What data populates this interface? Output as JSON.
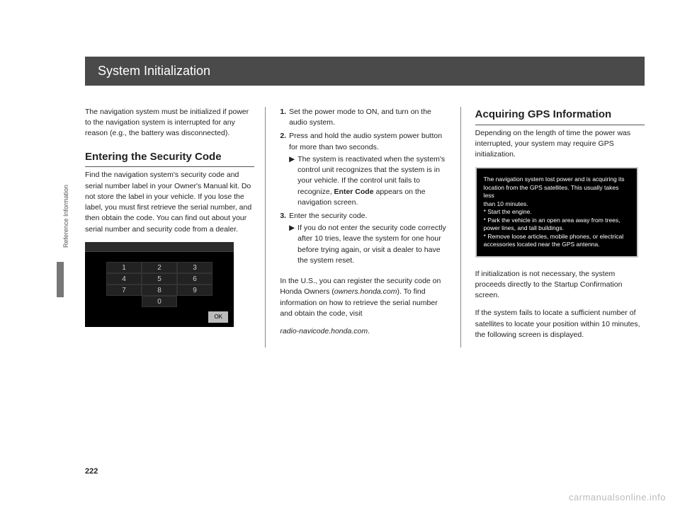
{
  "sidebar": {
    "label": "Reference Information"
  },
  "page_number": "222",
  "watermark": "carmanualsonline.info",
  "header": {
    "title": "System Initialization"
  },
  "col1": {
    "intro": "The navigation system must be initialized if power to the navigation system is interrupted for any reason (e.g., the battery was disconnected).",
    "heading": "Entering the Security Code",
    "body": "Find the navigation system's security code and serial number label in your Owner's Manual kit. Do not store the label in your vehicle. If you lose the label, you must first retrieve the serial number, and then obtain the code. You can find out about your serial number and security code from a dealer.",
    "keypad": [
      "1",
      "2",
      "3",
      "4",
      "5",
      "6",
      "7",
      "8",
      "9",
      "",
      "0",
      ""
    ],
    "ok": "OK"
  },
  "col2": {
    "step1_num": "1.",
    "step1": "Set the power mode to ON, and turn on the audio system.",
    "step2_num": "2.",
    "step2": "Press and hold the audio system power button for more than two seconds.",
    "step2_sub_a": "The system is reactivated when the system's control unit recognizes that the system is in your vehicle. If the control unit fails to recognize, ",
    "step2_sub_bold": "Enter Code",
    "step2_sub_b": " appears on the navigation screen.",
    "step3_num": "3.",
    "step3": "Enter the security code.",
    "step3_sub": "If you do not enter the security code correctly after 10 tries, leave the system for one hour before trying again, or visit a dealer to have the system reset.",
    "tri": "▶",
    "footer_a": "In the U.S., you can register the security code on Honda Owners (",
    "footer_link1": "owners.honda.com",
    "footer_b": "). To find information on how to retrieve the serial number and obtain the code, visit",
    "footer_link2": "radio-navicode.honda.com",
    "footer_c": "."
  },
  "col3": {
    "heading": "Acquiring GPS Information",
    "intro": "Depending on the length of time the power was interrupted, your system may require GPS initialization.",
    "box_l1": "The navigation system lost power and is acquiring its",
    "box_l2": "location from the GPS satellites. This usually takes less",
    "box_l3": "than 10 minutes.",
    "box_l4": "* Start the engine.",
    "box_l5": "* Park the vehicle in an open area away from trees,",
    "box_l6": "power lines, and tall buildings.",
    "box_l7": "* Remove loose articles, mobile phones, or electrical",
    "box_l8": "accessories located near the GPS antenna.",
    "p1": "If initialization is not necessary, the system proceeds directly to the Startup Confirmation screen.",
    "p2": "If the system fails to locate a sufficient number of satellites to locate your position within 10 minutes, the following screen is displayed."
  }
}
